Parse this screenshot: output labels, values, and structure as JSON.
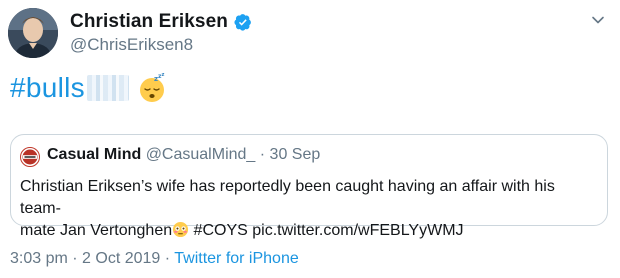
{
  "author": {
    "display_name": "Christian Eriksen",
    "handle": "@ChrisEriksen8",
    "verified": true,
    "avatar_icon": "avatar-photo"
  },
  "menu": {
    "icon": "chevron-down-icon"
  },
  "tweet": {
    "text": "#bulls",
    "redacted_icon": "blurred-text",
    "emoji": "sleeping-face-emoji",
    "hashtag_color": "#1b95e0"
  },
  "quoted_tweet": {
    "display_name": "Casual Mind",
    "handle": "@CasualMind_",
    "separator": "·",
    "date": "30 Sep",
    "line1": "Christian Eriksen’s wife has reportedly been caught having an affair with his team-",
    "line2_prefix": "mate Jan Vertonghen",
    "emoji": "flushed-face-emoji",
    "line2_suffix": " #COYS pic.twitter.com/wFEBLYyWMJ"
  },
  "meta": {
    "time": "3:03 pm",
    "separator1": " · ",
    "date": "2 Oct 2019",
    "separator2": " · ",
    "source": "Twitter for iPhone"
  },
  "colors": {
    "link": "#1b95e0",
    "muted": "#657786",
    "border": "#ccd6dd",
    "text": "#14171a"
  }
}
